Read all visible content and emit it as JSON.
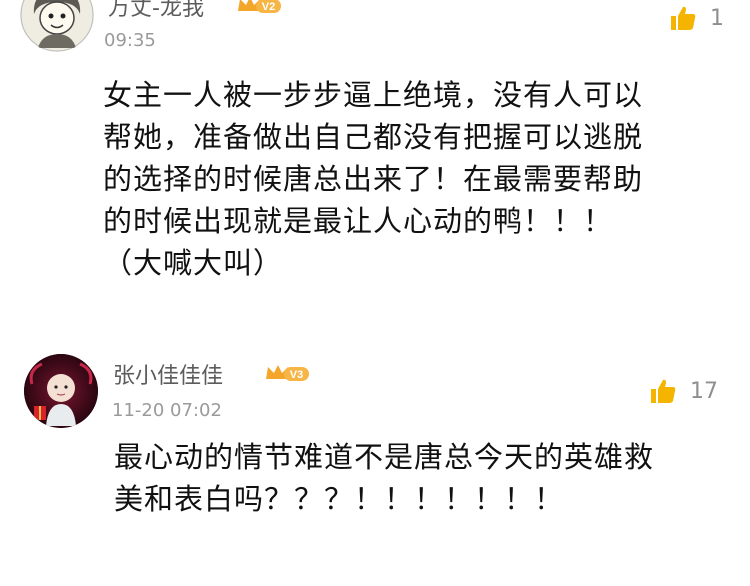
{
  "comments": [
    {
      "username": "万丈-龙我",
      "vip_level": "V2",
      "timestamp": "09:35",
      "likes": "1",
      "text_lines": [
        "女主一人被一步步逼上绝境，没有人可以",
        "帮她，准备做出自己都没有把握可以逃脱",
        "的选择的时候唐总出来了！在最需要帮助",
        "的时候出现就是最让人心动的鸭！！！",
        "（大喊大叫）"
      ],
      "avatar_icon": "cartoon-avatar"
    },
    {
      "username": "张小佳佳佳",
      "vip_level": "V3",
      "timestamp": "11-20 07:02",
      "likes": "17",
      "text_lines": [
        "最心动的情节难道不是唐总今天的英雄救",
        "美和表白吗？？？！！！！！！！"
      ],
      "avatar_icon": "photo-avatar"
    }
  ],
  "colors": {
    "like_icon": "#f5b400",
    "vip_badge": "#f4a62a",
    "username": "#5c5c5c",
    "timestamp": "#9a9a9a"
  }
}
